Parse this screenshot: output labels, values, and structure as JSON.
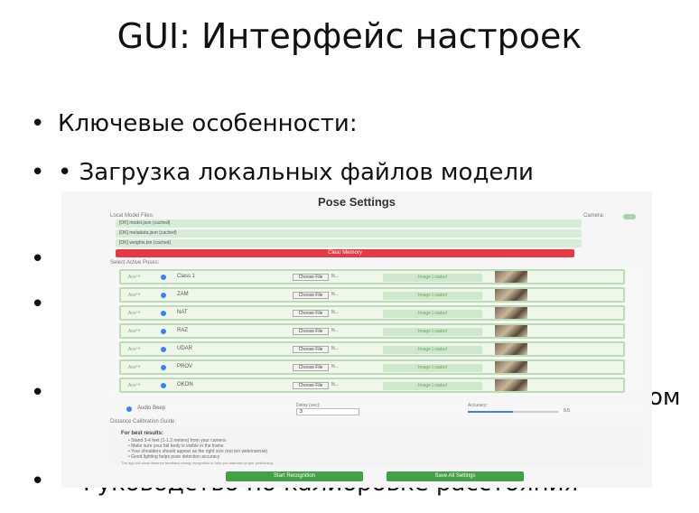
{
  "slide": {
    "title": "GUI: Интерфейс настроек",
    "bullets": [
      {
        "dot": "•",
        "text": "Ключевые особенности:"
      },
      {
        "dot": "•",
        "text": "• Загрузка локальных файлов модели"
      }
    ],
    "stray_dot": "•",
    "partial_right": "ом",
    "bottom_text": "Руководство по калибровке расстояния"
  },
  "settings_window": {
    "title": "Pose Settings",
    "local_files_label": "Local Model Files:",
    "camera_label": "Camera:",
    "files": [
      "[OK] model.json (cached)",
      "[OK] metadata.json (cached)",
      "[OK] weights.bin (cached)"
    ],
    "clear_button": "Clear Memory",
    "select_poses_label": "Select Active Poses:",
    "poses": [
      {
        "toggle": "Ace™",
        "name": "Class 1",
        "choose": "Choose File",
        "nofile": "N...",
        "status": "Image Loaded"
      },
      {
        "toggle": "Ace™",
        "name": "ZAM",
        "choose": "Choose File",
        "nofile": "N...",
        "status": "Image Loaded"
      },
      {
        "toggle": "Ace™",
        "name": "NAT",
        "choose": "Choose File",
        "nofile": "N...",
        "status": "Image Loaded"
      },
      {
        "toggle": "Ace™",
        "name": "RAZ",
        "choose": "Choose File",
        "nofile": "N...",
        "status": "Image Loaded"
      },
      {
        "toggle": "Ace™",
        "name": "UDAR",
        "choose": "Choose File",
        "nofile": "N...",
        "status": "Image Loaded"
      },
      {
        "toggle": "Ace™",
        "name": "PROV",
        "choose": "Choose File",
        "nofile": "N...",
        "status": "Image Loaded"
      },
      {
        "toggle": "Ace™",
        "name": "OKON",
        "choose": "Choose File",
        "nofile": "N...",
        "status": "Image Loaded"
      }
    ],
    "audio_label": "Audio Beep",
    "delay_label": "Delay (sec):",
    "delay_value": "3",
    "accuracy_label": "Accuracy:",
    "accuracy_value": "0.5",
    "accuracy_fraction": 0.5,
    "guide_label": "Distance Calibration Guide:",
    "guide_title": "For best results:",
    "guide_items": [
      "Stand 3-4 feet (1-1.2 meters) from your camera",
      "Make sure your full body is visible in the frame",
      "Your shoulders should appear as the right size (not too wide/narrow)",
      "Good lighting helps pose detection accuracy"
    ],
    "guide_note": "The app will show distance feedback during recognition to help you maintain proper positioning.",
    "start_button": "Start Recognition",
    "save_button": "Save All Settings"
  },
  "colors": {
    "clear_button": "#e53945",
    "primary_green": "#43a047",
    "pose_row_bg": "#eef7ea",
    "accent_blue": "#3b82f6"
  }
}
